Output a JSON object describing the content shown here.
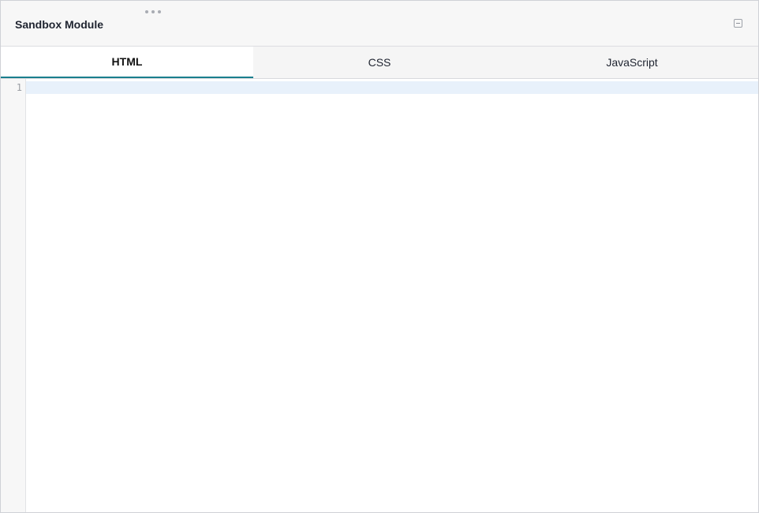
{
  "module": {
    "title": "Sandbox Module",
    "collapse_icon": "collapse-icon"
  },
  "tabs": [
    {
      "label": "HTML",
      "active": true
    },
    {
      "label": "CSS",
      "active": false
    },
    {
      "label": "JavaScript",
      "active": false
    }
  ],
  "editor": {
    "line_numbers": [
      "1"
    ],
    "content": ""
  },
  "colors": {
    "active_tab_underline": "#1a7f8e",
    "active_line_highlight": "#e8f1fb"
  }
}
